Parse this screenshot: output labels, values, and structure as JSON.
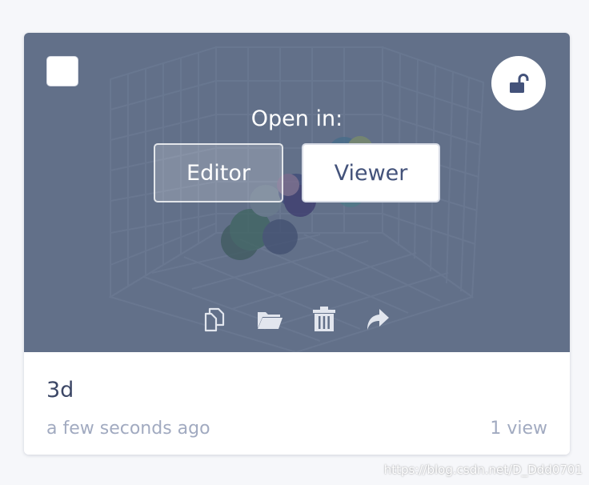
{
  "card": {
    "title": "3d",
    "timestamp": "a few seconds ago",
    "views": "1 view"
  },
  "overlay": {
    "open_in_label": "Open in:",
    "editor_label": "Editor",
    "viewer_label": "Viewer"
  },
  "actions": [
    {
      "icon": "copy-icon"
    },
    {
      "icon": "folder-icon"
    },
    {
      "icon": "trash-icon"
    },
    {
      "icon": "share-icon"
    }
  ],
  "lock": {
    "icon": "unlock-icon"
  },
  "watermark": "https://blog.csdn.net/D_Ddd0701",
  "colors": {
    "overlay": "#627089",
    "viewer_text": "#43527a",
    "title_text": "#3c4766",
    "meta_text": "#a1aac0"
  }
}
